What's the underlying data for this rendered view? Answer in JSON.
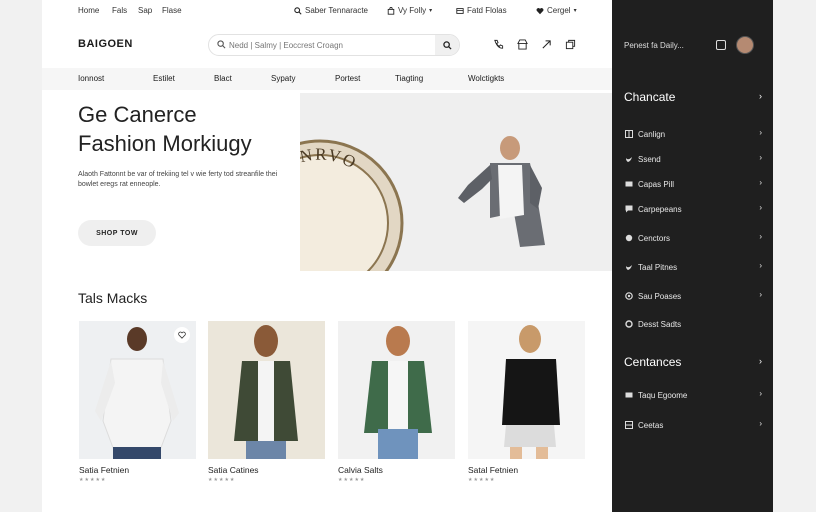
{
  "topbar": {
    "links": [
      "Home",
      "Fals",
      "Sap",
      "Flase"
    ],
    "search_label": "Saber Tennaracte",
    "my_label": "Vy Folly",
    "deals_label": "Fatd Flolas",
    "cart_label": "Cergel"
  },
  "header": {
    "logo": "BAIGOEN",
    "search_placeholder": "Nedd | Salmy | Eoccrest Croagn"
  },
  "categories": [
    "Ionnost",
    "Estilet",
    "Blact",
    "Sypaty",
    "Portest",
    "Tiagting",
    "Wolctigkts"
  ],
  "hero": {
    "title_line1": "Ge Canerce",
    "title_line2": "Fashion Morkiugy",
    "subtitle": "Alaoth Fattonnt be var of trekiing tel v wie ferty tod streanfile thei bowlet eregs rat enneople.",
    "cta": "SHOP TOW",
    "badge_text": "LOTAINRVO"
  },
  "products_section": {
    "title": "Tals Macks",
    "items": [
      {
        "name": "Satia Fetnien",
        "stars": "★★★★★"
      },
      {
        "name": "Satia Catines",
        "stars": "★★★★★"
      },
      {
        "name": "Calvia Salts",
        "stars": "★★★★★"
      },
      {
        "name": "Satal Fetnien",
        "stars": "★★★★★"
      }
    ]
  },
  "sidebar": {
    "top_text": "Penest fa Daily...",
    "section1_title": "Chancate",
    "section1_items": [
      "Canlign",
      "Ssend",
      "Capas Pill",
      "Carpepeans",
      "Cenctors",
      "Taal Pitnes",
      "Sau Poases",
      "Desst Sadts"
    ],
    "section2_title": "Centances",
    "section2_items": [
      "Taqu Egoome",
      "Ceetas"
    ]
  },
  "colors": {
    "sidebar_bg": "#1f1f1f",
    "page_bg": "#ffffff",
    "accent": "#1a1a1a"
  }
}
